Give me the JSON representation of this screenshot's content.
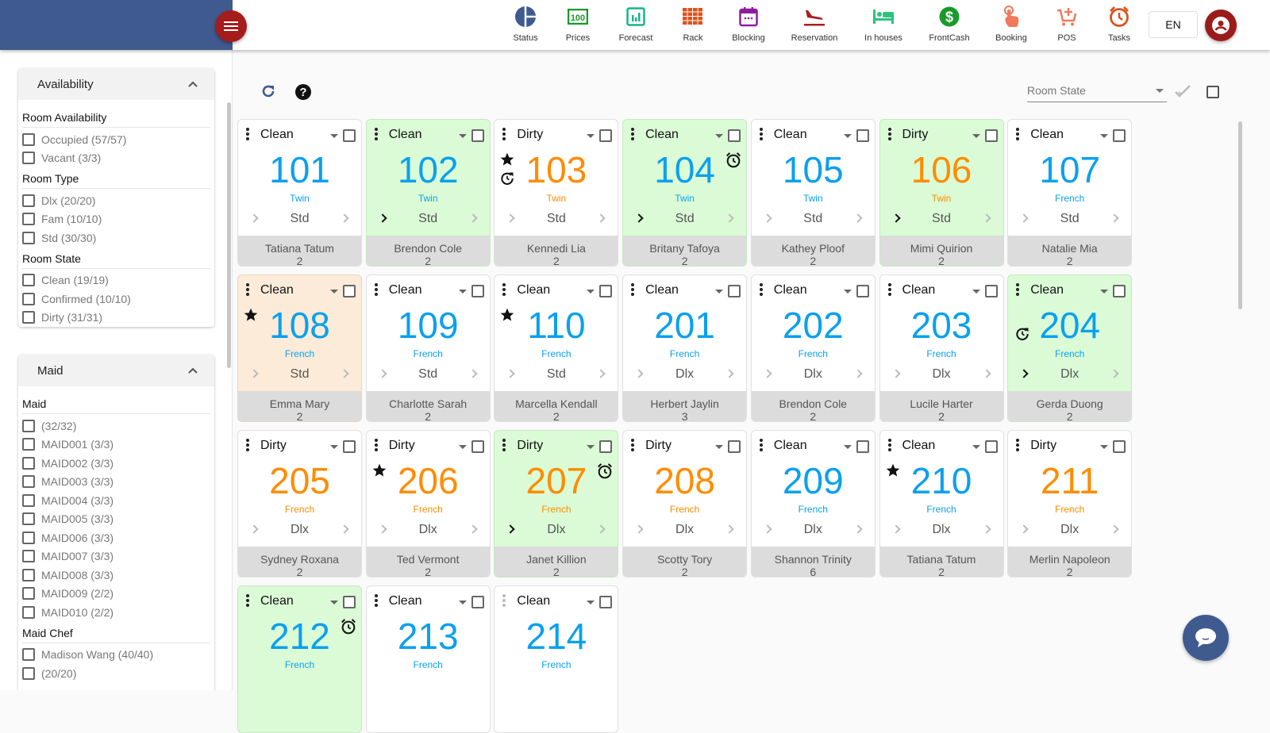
{
  "header": {
    "menu_icon": "hamburger-menu-icon",
    "nav": [
      {
        "id": "status",
        "label": "Status",
        "icon": "pie-chart-icon",
        "color": "#3f5a8f"
      },
      {
        "id": "prices",
        "label": "Prices",
        "icon": "price-tag-100-icon",
        "color": "#1a9a2a"
      },
      {
        "id": "forecast",
        "label": "Forecast",
        "icon": "bar-chart-icon",
        "color": "#19b38c"
      },
      {
        "id": "rack",
        "label": "Rack",
        "icon": "grid-icon",
        "color": "#e0521c"
      },
      {
        "id": "blocking",
        "label": "Blocking",
        "icon": "calendar-icon",
        "color": "#8e1ca0"
      },
      {
        "id": "reservation",
        "label": "Reservation",
        "icon": "plane-landing-icon",
        "color": "#a82020"
      },
      {
        "id": "inhouses",
        "label": "In houses",
        "icon": "bed-icon",
        "color": "#2ec27e"
      },
      {
        "id": "frontcash",
        "label": "FrontCash",
        "icon": "dollar-circle-icon",
        "color": "#1a9a2a"
      },
      {
        "id": "booking",
        "label": "Booking",
        "icon": "hand-pointer-icon",
        "color": "#f07a5a"
      },
      {
        "id": "pos",
        "label": "POS",
        "icon": "cart-plus-icon",
        "color": "#f07a5a"
      },
      {
        "id": "tasks",
        "label": "Tasks",
        "icon": "alarm-clock-icon",
        "color": "#d9541c"
      }
    ],
    "language": "EN",
    "user_icon": "account-circle-icon",
    "brand_color": "#3f5a8f",
    "accent_color": "#a51c1c"
  },
  "sidebar": {
    "availability": {
      "title": "Availability",
      "groups": [
        {
          "title": "Room Availability",
          "options": [
            "Occupied (57/57)",
            "Vacant (3/3)"
          ]
        },
        {
          "title": "Room Type",
          "options": [
            "Dlx (20/20)",
            "Fam (10/10)",
            "Std (30/30)"
          ]
        },
        {
          "title": "Room State",
          "options": [
            "Clean (19/19)",
            "Confirmed (10/10)",
            "Dirty (31/31)"
          ]
        }
      ]
    },
    "maid": {
      "title": "Maid",
      "groups": [
        {
          "title": "Maid",
          "options": [
            "(32/32)",
            "MAID001 (3/3)",
            "MAID002 (3/3)",
            "MAID003 (3/3)",
            "MAID004 (3/3)",
            "MAID005 (3/3)",
            "MAID006 (3/3)",
            "MAID007 (3/3)",
            "MAID008 (3/3)",
            "MAID009 (2/2)",
            "MAID010 (2/2)"
          ]
        },
        {
          "title": "Maid Chef",
          "options": [
            "Madison Wang (40/40)",
            "(20/20)"
          ]
        }
      ]
    }
  },
  "toolbar": {
    "refresh_icon": "refresh-icon",
    "help_icon": "help-circle-icon",
    "room_state_placeholder": "Room State",
    "apply_icon": "double-check-icon",
    "select_all_icon": "checkbox-icon"
  },
  "rooms": [
    {
      "number": "101",
      "state": "Clean",
      "bed": "Twin",
      "type": "Std",
      "guest": "Tatiana Tatum",
      "pax": "2",
      "bg": "white",
      "left_active": false,
      "icons": []
    },
    {
      "number": "102",
      "state": "Clean",
      "bed": "Twin",
      "type": "Std",
      "guest": "Brendon Cole",
      "pax": "2",
      "bg": "green",
      "left_active": true,
      "icons": []
    },
    {
      "number": "103",
      "state": "Dirty",
      "bed": "Twin",
      "type": "Std",
      "guest": "Kennedi Lia",
      "pax": "2",
      "bg": "white",
      "left_active": false,
      "icons": [
        "star",
        "history"
      ]
    },
    {
      "number": "104",
      "state": "Clean",
      "bed": "Twin",
      "type": "Std",
      "guest": "Britany Tafoya",
      "pax": "2",
      "bg": "green",
      "left_active": true,
      "icons": [
        "alarm"
      ]
    },
    {
      "number": "105",
      "state": "Clean",
      "bed": "Twin",
      "type": "Std",
      "guest": "Kathey Ploof",
      "pax": "2",
      "bg": "white",
      "left_active": false,
      "icons": []
    },
    {
      "number": "106",
      "state": "Dirty",
      "bed": "Twin",
      "type": "Std",
      "guest": "Mimi Quirion",
      "pax": "2",
      "bg": "green",
      "left_active": true,
      "icons": []
    },
    {
      "number": "107",
      "state": "Clean",
      "bed": "French",
      "type": "Std",
      "guest": "Natalie Mia",
      "pax": "2",
      "bg": "white",
      "left_active": false,
      "icons": []
    },
    {
      "number": "108",
      "state": "Clean",
      "bed": "French",
      "type": "Std",
      "guest": "Emma Mary",
      "pax": "2",
      "bg": "peach",
      "left_active": false,
      "icons": [
        "star"
      ]
    },
    {
      "number": "109",
      "state": "Clean",
      "bed": "French",
      "type": "Std",
      "guest": "Charlotte Sarah",
      "pax": "2",
      "bg": "white",
      "left_active": false,
      "icons": []
    },
    {
      "number": "110",
      "state": "Clean",
      "bed": "French",
      "type": "Std",
      "guest": "Marcella Kendall",
      "pax": "2",
      "bg": "white",
      "left_active": false,
      "icons": [
        "star"
      ]
    },
    {
      "number": "201",
      "state": "Clean",
      "bed": "French",
      "type": "Dlx",
      "guest": "Herbert Jaylin",
      "pax": "3",
      "bg": "white",
      "left_active": false,
      "icons": []
    },
    {
      "number": "202",
      "state": "Clean",
      "bed": "French",
      "type": "Dlx",
      "guest": "Brendon Cole",
      "pax": "2",
      "bg": "white",
      "left_active": false,
      "icons": []
    },
    {
      "number": "203",
      "state": "Clean",
      "bed": "French",
      "type": "Dlx",
      "guest": "Lucile Harter",
      "pax": "2",
      "bg": "white",
      "left_active": false,
      "icons": []
    },
    {
      "number": "204",
      "state": "Clean",
      "bed": "French",
      "type": "Dlx",
      "guest": "Gerda Duong",
      "pax": "2",
      "bg": "green",
      "left_active": true,
      "icons": [
        "history-low"
      ]
    },
    {
      "number": "205",
      "state": "Dirty",
      "bed": "French",
      "type": "Dlx",
      "guest": "Sydney Roxana",
      "pax": "2",
      "bg": "white",
      "left_active": false,
      "icons": []
    },
    {
      "number": "206",
      "state": "Dirty",
      "bed": "French",
      "type": "Dlx",
      "guest": "Ted Vermont",
      "pax": "2",
      "bg": "white",
      "left_active": false,
      "icons": [
        "star"
      ]
    },
    {
      "number": "207",
      "state": "Dirty",
      "bed": "French",
      "type": "Dlx",
      "guest": "Janet Killion",
      "pax": "2",
      "bg": "green",
      "left_active": true,
      "icons": [
        "alarm"
      ]
    },
    {
      "number": "208",
      "state": "Dirty",
      "bed": "French",
      "type": "Dlx",
      "guest": "Scotty Tory",
      "pax": "2",
      "bg": "white",
      "left_active": false,
      "icons": []
    },
    {
      "number": "209",
      "state": "Clean",
      "bed": "French",
      "type": "Dlx",
      "guest": "Shannon Trinity",
      "pax": "6",
      "bg": "white",
      "left_active": false,
      "icons": []
    },
    {
      "number": "210",
      "state": "Clean",
      "bed": "French",
      "type": "Dlx",
      "guest": "Tatiana Tatum",
      "pax": "2",
      "bg": "white",
      "left_active": false,
      "icons": [
        "star"
      ]
    },
    {
      "number": "211",
      "state": "Dirty",
      "bed": "French",
      "type": "Dlx",
      "guest": "Merlin Napoleon",
      "pax": "2",
      "bg": "white",
      "left_active": false,
      "icons": []
    },
    {
      "number": "212",
      "state": "Clean",
      "bed": "French",
      "type": "",
      "guest": "",
      "pax": "",
      "bg": "green",
      "left_active": false,
      "icons": [
        "alarm"
      ]
    },
    {
      "number": "213",
      "state": "Clean",
      "bed": "French",
      "type": "",
      "guest": "",
      "pax": "",
      "bg": "white",
      "left_active": false,
      "icons": []
    },
    {
      "number": "214",
      "state": "Clean",
      "bed": "French",
      "type": "",
      "guest": "",
      "pax": "",
      "bg": "white",
      "left_active": false,
      "icons": [],
      "faint_menu": true
    }
  ],
  "state_colors": {
    "Clean": "#0aa0ef",
    "Dirty": "#ff8c00"
  },
  "chat_icon": "chat-bubble-icon"
}
